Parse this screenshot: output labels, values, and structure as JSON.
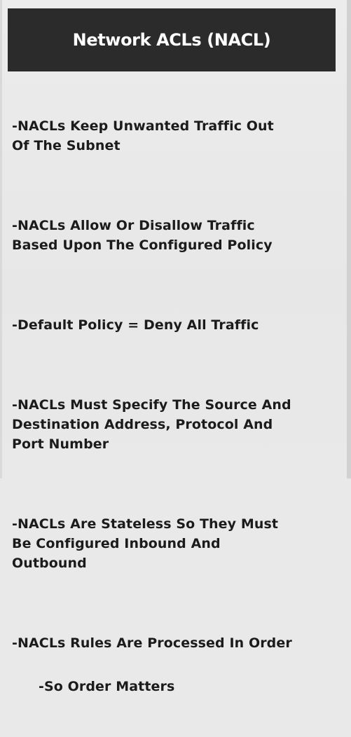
{
  "slide": {
    "title": "Network ACLs (NACL)",
    "bullets": [
      "-NACLs Keep Unwanted Traffic Out\n   Of The Subnet",
      "-NACLs Allow Or Disallow Traffic\n   Based Upon The Configured Policy",
      "-Default Policy = Deny All Traffic",
      "-NACLs Must Specify The Source And\n   Destination Address, Protocol And\n   Port Number",
      "-NACLs Are Stateless So They Must\n   Be Configured Inbound And\n   Outbound",
      "-NACLs Rules Are Processed In Order"
    ],
    "sub_bullet": "-So Order Matters"
  },
  "colors": {
    "title_bar": "#2b2b2b",
    "title_text": "#ffffff",
    "body_text": "#1b1b1b",
    "background": "#e9e9e9"
  }
}
